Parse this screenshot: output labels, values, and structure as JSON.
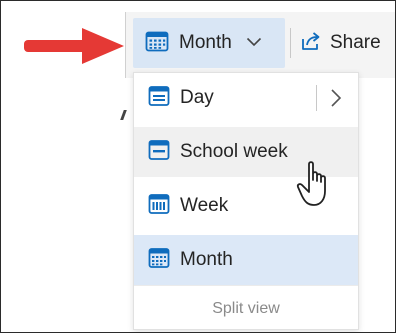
{
  "toolbar": {
    "view_button_label": "Month",
    "share_label": "Share"
  },
  "menu": {
    "items": [
      {
        "label": "Day",
        "icon": "calendar-day-icon",
        "state": "normal",
        "has_submenu": true
      },
      {
        "label": "School week",
        "icon": "calendar-work-week-icon",
        "state": "hover",
        "has_submenu": false
      },
      {
        "label": "Week",
        "icon": "calendar-week-icon",
        "state": "normal",
        "has_submenu": false
      },
      {
        "label": "Month",
        "icon": "calendar-month-icon",
        "state": "selected",
        "has_submenu": false
      }
    ],
    "split_view_label": "Split view"
  },
  "colors": {
    "accent": "#0f6cbd",
    "selected_bg": "#dce8f7",
    "hover_bg": "#f0f0f0",
    "arrow": "#e53935"
  }
}
